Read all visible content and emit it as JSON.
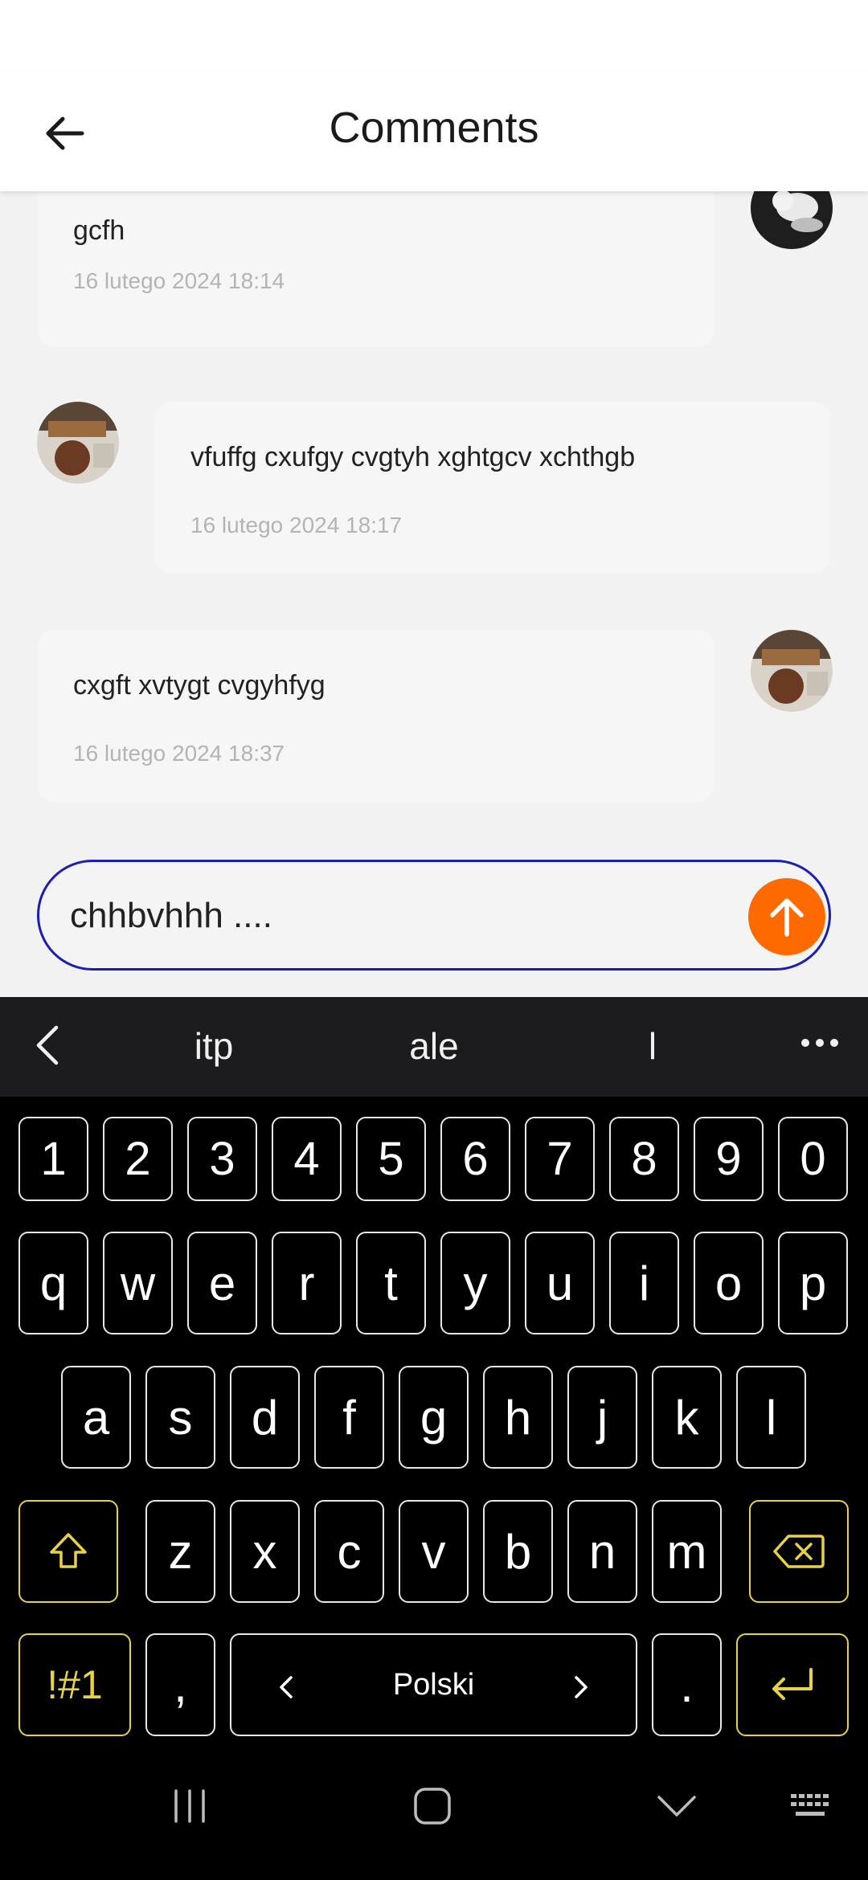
{
  "header": {
    "title": "Comments"
  },
  "comments": [
    {
      "text": "gcfh",
      "date": "16 lutego 2024 18:14"
    },
    {
      "text": "vfuffg cxufgy cvgtyh xghtgcv xchthgb",
      "date": "16 lutego 2024 18:17"
    },
    {
      "text": "cxgft xvtygt cvgyhfyg",
      "date": "16 lutego 2024 18:37"
    }
  ],
  "composer": {
    "value": "chhbvhhh ...."
  },
  "suggestions": [
    "itp",
    "ale",
    "l"
  ],
  "keyboard": {
    "numbers": [
      "1",
      "2",
      "3",
      "4",
      "5",
      "6",
      "7",
      "8",
      "9",
      "0"
    ],
    "row1": [
      "q",
      "w",
      "e",
      "r",
      "t",
      "y",
      "u",
      "i",
      "o",
      "p"
    ],
    "row2": [
      "a",
      "s",
      "d",
      "f",
      "g",
      "h",
      "j",
      "k",
      "l"
    ],
    "row3": [
      "z",
      "x",
      "c",
      "v",
      "b",
      "n",
      "m"
    ],
    "symbols_label": "!#1",
    "comma": ",",
    "period": ".",
    "language": "Polski"
  },
  "colors": {
    "accent": "#ff6a00",
    "input_border": "#1a1fb0",
    "special_key": "#e6d14a"
  }
}
